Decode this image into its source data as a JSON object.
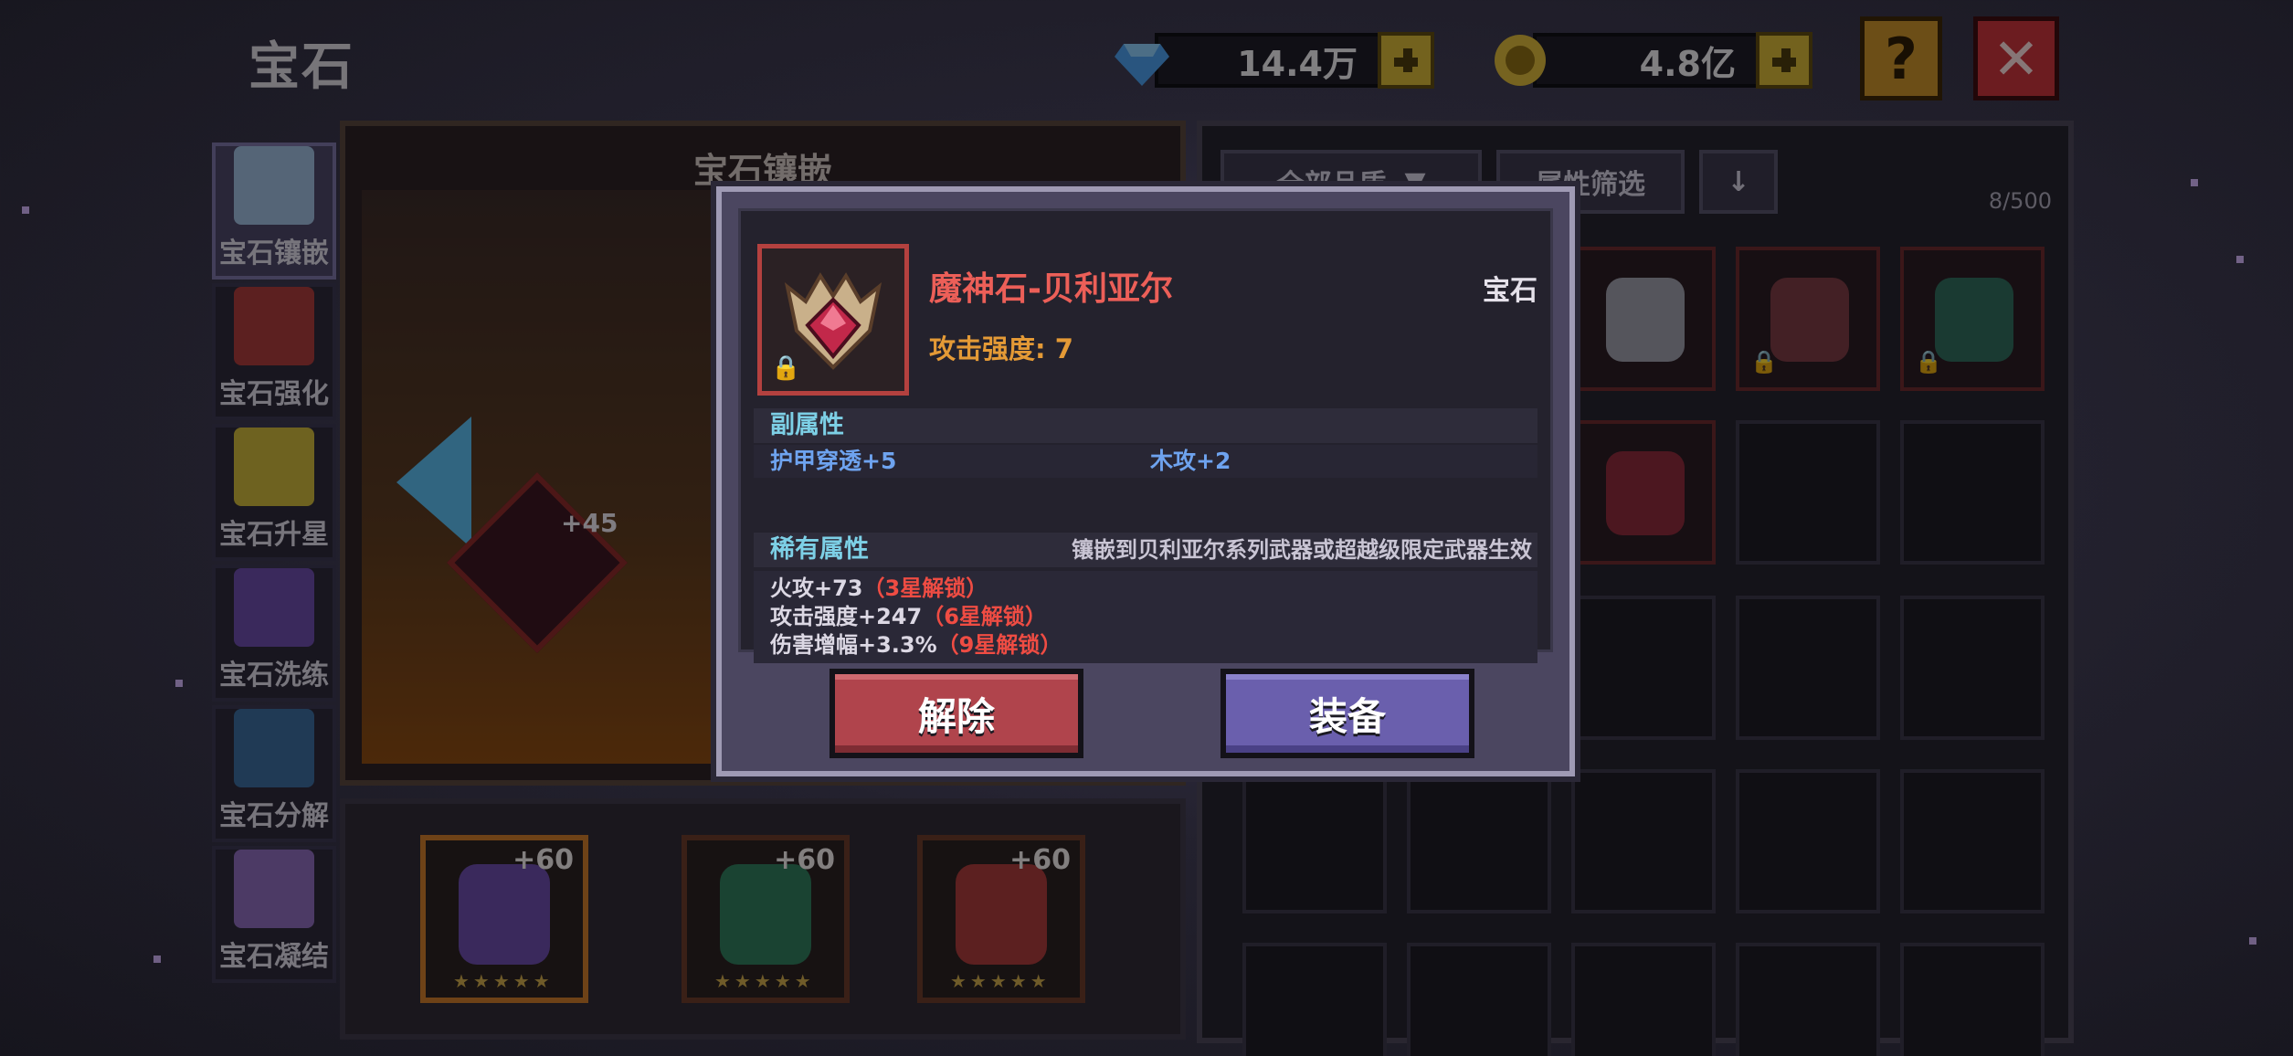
{
  "header": {
    "title": "宝石",
    "diamonds": "14.4万",
    "gold": "4.8亿",
    "help_label": "?",
    "close_label": "✕"
  },
  "side_nav": [
    {
      "label": "宝石镶嵌",
      "active": true
    },
    {
      "label": "宝石强化"
    },
    {
      "label": "宝石升星"
    },
    {
      "label": "宝石洗练"
    },
    {
      "label": "宝石分解"
    },
    {
      "label": "宝石凝结"
    }
  ],
  "inlay": {
    "title": "宝石镶嵌",
    "center_level": "+45",
    "bottom_slots": [
      {
        "level": "+60"
      },
      {
        "level": "+60"
      },
      {
        "level": "+60"
      }
    ]
  },
  "inventory": {
    "quality_filter": "全部品质",
    "attr_filter": "属性筛选",
    "count": "8/500"
  },
  "modal": {
    "item_name": "魔神石-贝利亚尔",
    "item_type": "宝石",
    "main_stat": "攻击强度: 7",
    "sub_section": "副属性",
    "sub_stats": [
      "护甲穿透+5",
      "木攻+2"
    ],
    "rare_section": "稀有属性",
    "rare_note": "镶嵌到贝利亚尔系列武器或超越级限定武器生效",
    "rare_stats": [
      {
        "text": "火攻+73",
        "unlock": "（3星解锁）"
      },
      {
        "text": "攻击强度+247",
        "unlock": "（6星解锁）"
      },
      {
        "text": "伤害增幅+3.3%",
        "unlock": "（9星解锁）"
      }
    ],
    "remove_label": "解除",
    "equip_label": "装备"
  },
  "colors": {
    "name_red": "#ec5f58",
    "main_stat_orange": "#e49a36",
    "section_cyan": "#7dd0e6",
    "sub_stat_blue": "#6ea3ef",
    "unlock_red": "#ef4c43",
    "remove_btn": "#b0444c",
    "equip_btn": "#6a5fad"
  }
}
